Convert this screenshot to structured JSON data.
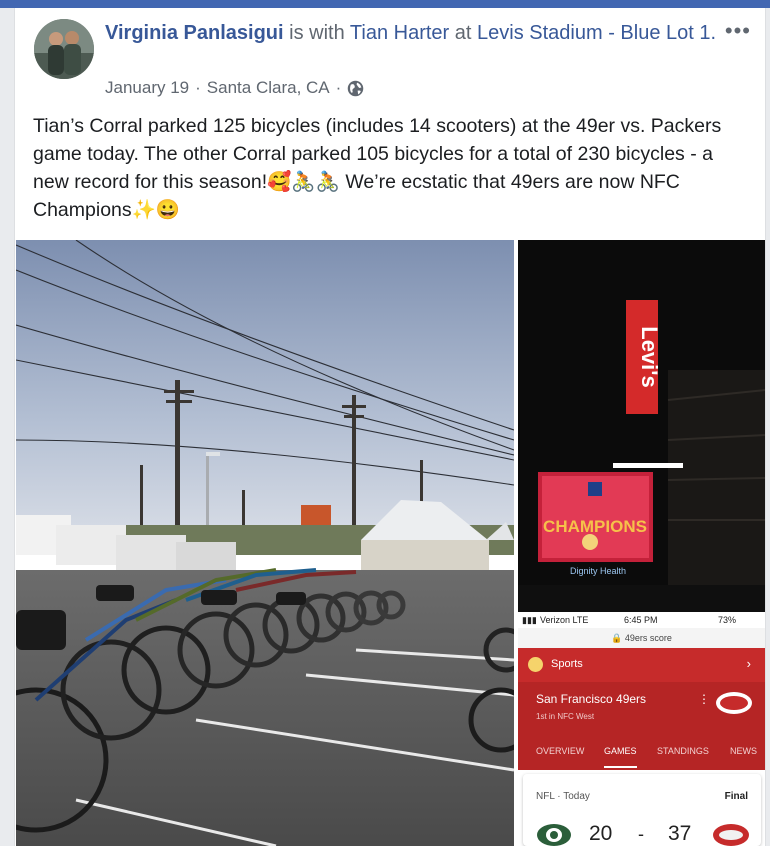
{
  "post": {
    "author": "Virginia Panlasigui",
    "with_text": "is with",
    "tagged": "Tian Harter",
    "at_text": "at",
    "place": "Levis Stadium - Blue Lot 1.",
    "date": "January 19",
    "location": "Santa Clara, CA",
    "separator": "·",
    "privacy_icon": "globe-icon",
    "more_label": "•••",
    "text": "Tian’s Corral parked 125 bicycles (includes 14 scooters) at the 49er vs. Packers game today. The other Corral parked 105 bicycles for a total of 230 bicycles - a new record for this season!🥰🚴🚴 We’re ecstatic that 49ers are now NFC Champions✨😀"
  },
  "photos": {
    "stadium": {
      "sign": "Levi's",
      "screen_text": "CHAMPIONS",
      "sponsor": "Dignity Health"
    },
    "phone": {
      "carrier": "Verizon  LTE",
      "time": "6:45 PM",
      "battery": "73%",
      "url": "49ers score",
      "section": "Sports",
      "team": "San Francisco 49ers",
      "standing": "1st in NFC West",
      "tabs": [
        "OVERVIEW",
        "GAMES",
        "STANDINGS",
        "NEWS"
      ],
      "game_label": "NFL · Today",
      "status": "Final",
      "home_score": "20",
      "dash": "-",
      "away_score": "37"
    }
  },
  "colors": {
    "link": "#385898",
    "niners_red": "#c62b2b",
    "packers_green": "#203731"
  }
}
